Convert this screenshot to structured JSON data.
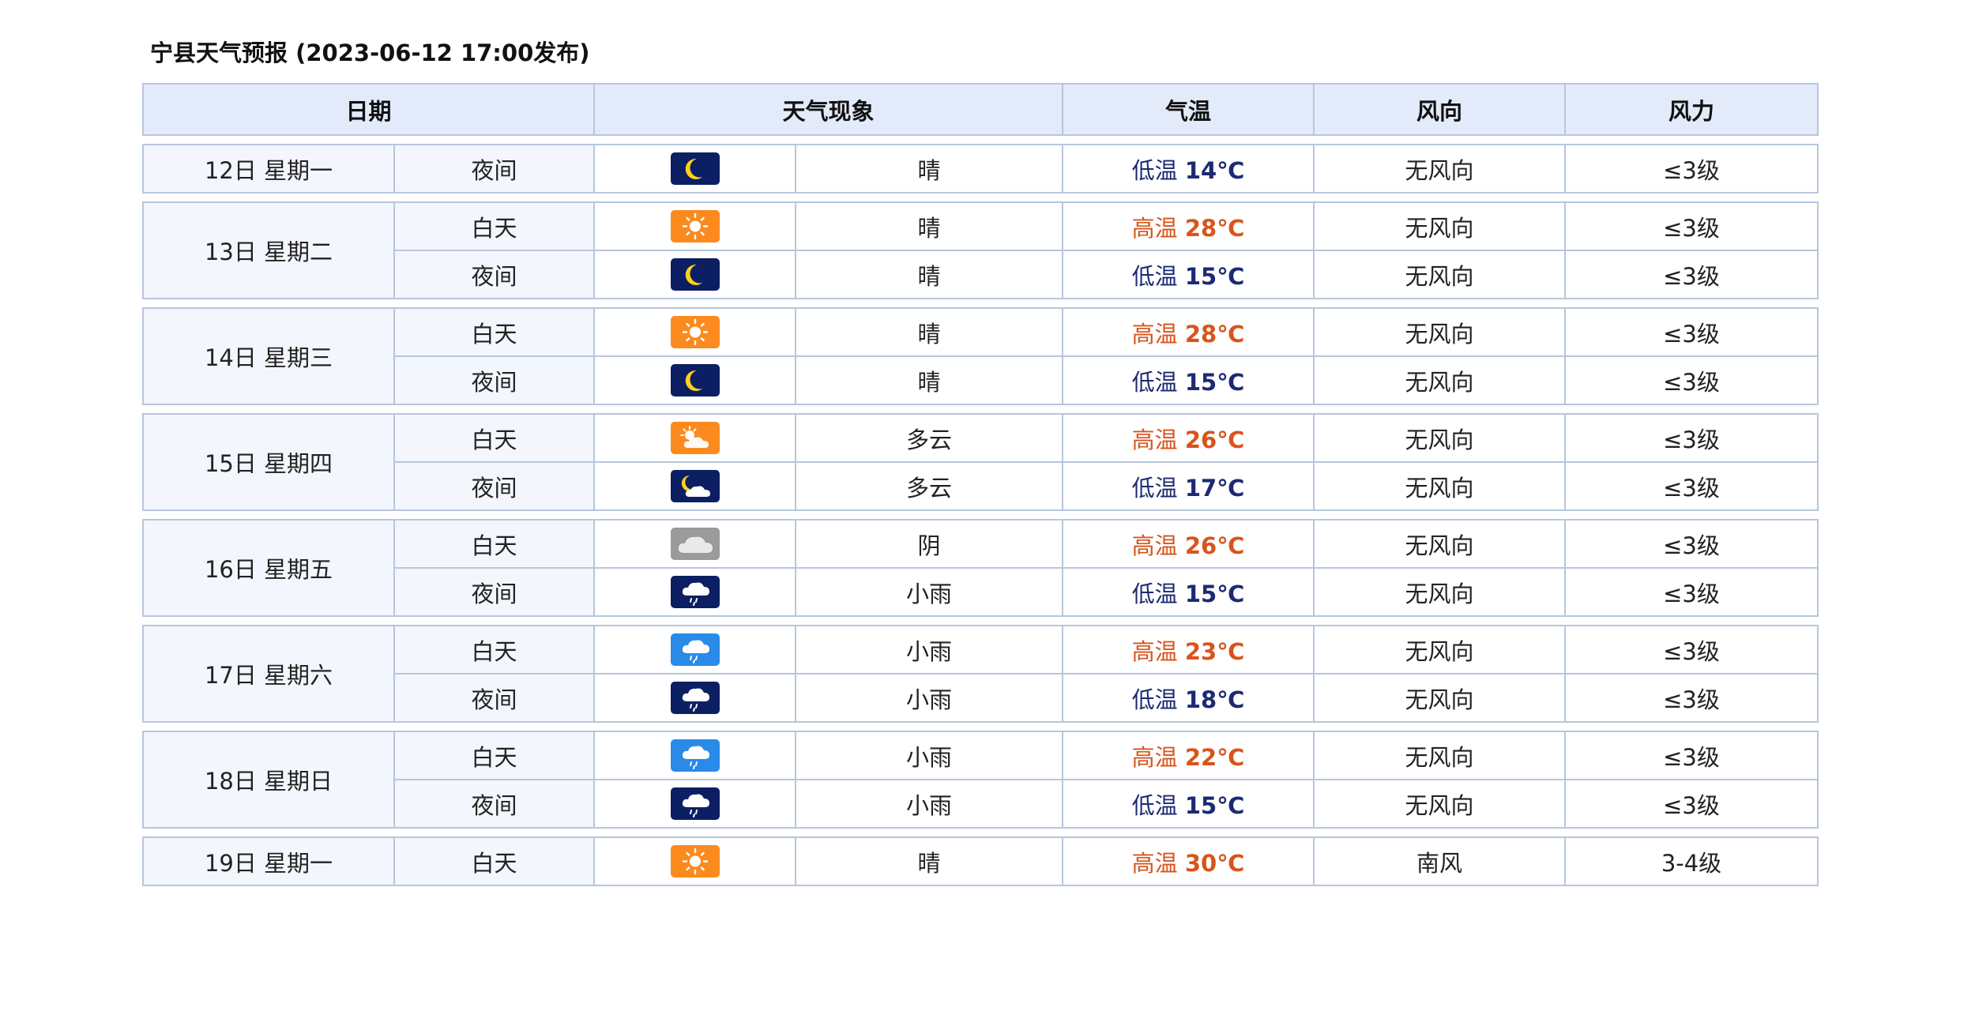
{
  "title": "宁县天气预报 (2023-06-12 17:00发布)",
  "headers": {
    "date": "日期",
    "weather": "天气现象",
    "temp": "气温",
    "wind_dir": "风向",
    "wind_force": "风力"
  },
  "icons": {
    "sunny": "sun-icon",
    "night_clear": "moon-icon",
    "partly_cloudy_day": "sun-cloud-icon",
    "partly_cloudy_night": "moon-cloud-icon",
    "overcast": "cloud-icon",
    "light_rain": "rain-cloud-icon"
  },
  "colors": {
    "header_bg": "#e3ebfb",
    "border": "#b7c6dc",
    "high_temp": "#d9541b",
    "low_temp": "#1b2a72",
    "sun_icon_bg": "#fb8a1f",
    "night_icon_bg": "#0d1f63"
  },
  "days": [
    {
      "date": "12日 星期一",
      "periods": [
        {
          "period": "夜间",
          "icon": "night",
          "weather": "晴",
          "temp_label": "低温",
          "temp": "14℃",
          "temp_type": "low",
          "wind_dir": "无风向",
          "wind_force": "≤3级"
        }
      ]
    },
    {
      "date": "13日 星期二",
      "periods": [
        {
          "period": "白天",
          "icon": "sunny",
          "weather": "晴",
          "temp_label": "高温",
          "temp": "28℃",
          "temp_type": "high",
          "wind_dir": "无风向",
          "wind_force": "≤3级"
        },
        {
          "period": "夜间",
          "icon": "night",
          "weather": "晴",
          "temp_label": "低温",
          "temp": "15℃",
          "temp_type": "low",
          "wind_dir": "无风向",
          "wind_force": "≤3级"
        }
      ]
    },
    {
      "date": "14日 星期三",
      "periods": [
        {
          "period": "白天",
          "icon": "sunny",
          "weather": "晴",
          "temp_label": "高温",
          "temp": "28℃",
          "temp_type": "high",
          "wind_dir": "无风向",
          "wind_force": "≤3级"
        },
        {
          "period": "夜间",
          "icon": "night",
          "weather": "晴",
          "temp_label": "低温",
          "temp": "15℃",
          "temp_type": "low",
          "wind_dir": "无风向",
          "wind_force": "≤3级"
        }
      ]
    },
    {
      "date": "15日 星期四",
      "periods": [
        {
          "period": "白天",
          "icon": "pcloud_day",
          "weather": "多云",
          "temp_label": "高温",
          "temp": "26℃",
          "temp_type": "high",
          "wind_dir": "无风向",
          "wind_force": "≤3级"
        },
        {
          "period": "夜间",
          "icon": "pcloud_night",
          "weather": "多云",
          "temp_label": "低温",
          "temp": "17℃",
          "temp_type": "low",
          "wind_dir": "无风向",
          "wind_force": "≤3级"
        }
      ]
    },
    {
      "date": "16日 星期五",
      "periods": [
        {
          "period": "白天",
          "icon": "overcast",
          "weather": "阴",
          "temp_label": "高温",
          "temp": "26℃",
          "temp_type": "high",
          "wind_dir": "无风向",
          "wind_force": "≤3级"
        },
        {
          "period": "夜间",
          "icon": "rain_night",
          "weather": "小雨",
          "temp_label": "低温",
          "temp": "15℃",
          "temp_type": "low",
          "wind_dir": "无风向",
          "wind_force": "≤3级"
        }
      ]
    },
    {
      "date": "17日 星期六",
      "periods": [
        {
          "period": "白天",
          "icon": "rain_day",
          "weather": "小雨",
          "temp_label": "高温",
          "temp": "23℃",
          "temp_type": "high",
          "wind_dir": "无风向",
          "wind_force": "≤3级"
        },
        {
          "period": "夜间",
          "icon": "rain_night",
          "weather": "小雨",
          "temp_label": "低温",
          "temp": "18℃",
          "temp_type": "low",
          "wind_dir": "无风向",
          "wind_force": "≤3级"
        }
      ]
    },
    {
      "date": "18日 星期日",
      "periods": [
        {
          "period": "白天",
          "icon": "rain_day",
          "weather": "小雨",
          "temp_label": "高温",
          "temp": "22℃",
          "temp_type": "high",
          "wind_dir": "无风向",
          "wind_force": "≤3级"
        },
        {
          "period": "夜间",
          "icon": "rain_night",
          "weather": "小雨",
          "temp_label": "低温",
          "temp": "15℃",
          "temp_type": "low",
          "wind_dir": "无风向",
          "wind_force": "≤3级"
        }
      ]
    },
    {
      "date": "19日 星期一",
      "periods": [
        {
          "period": "白天",
          "icon": "sunny",
          "weather": "晴",
          "temp_label": "高温",
          "temp": "30℃",
          "temp_type": "high",
          "wind_dir": "南风",
          "wind_force": "3-4级"
        }
      ]
    }
  ]
}
